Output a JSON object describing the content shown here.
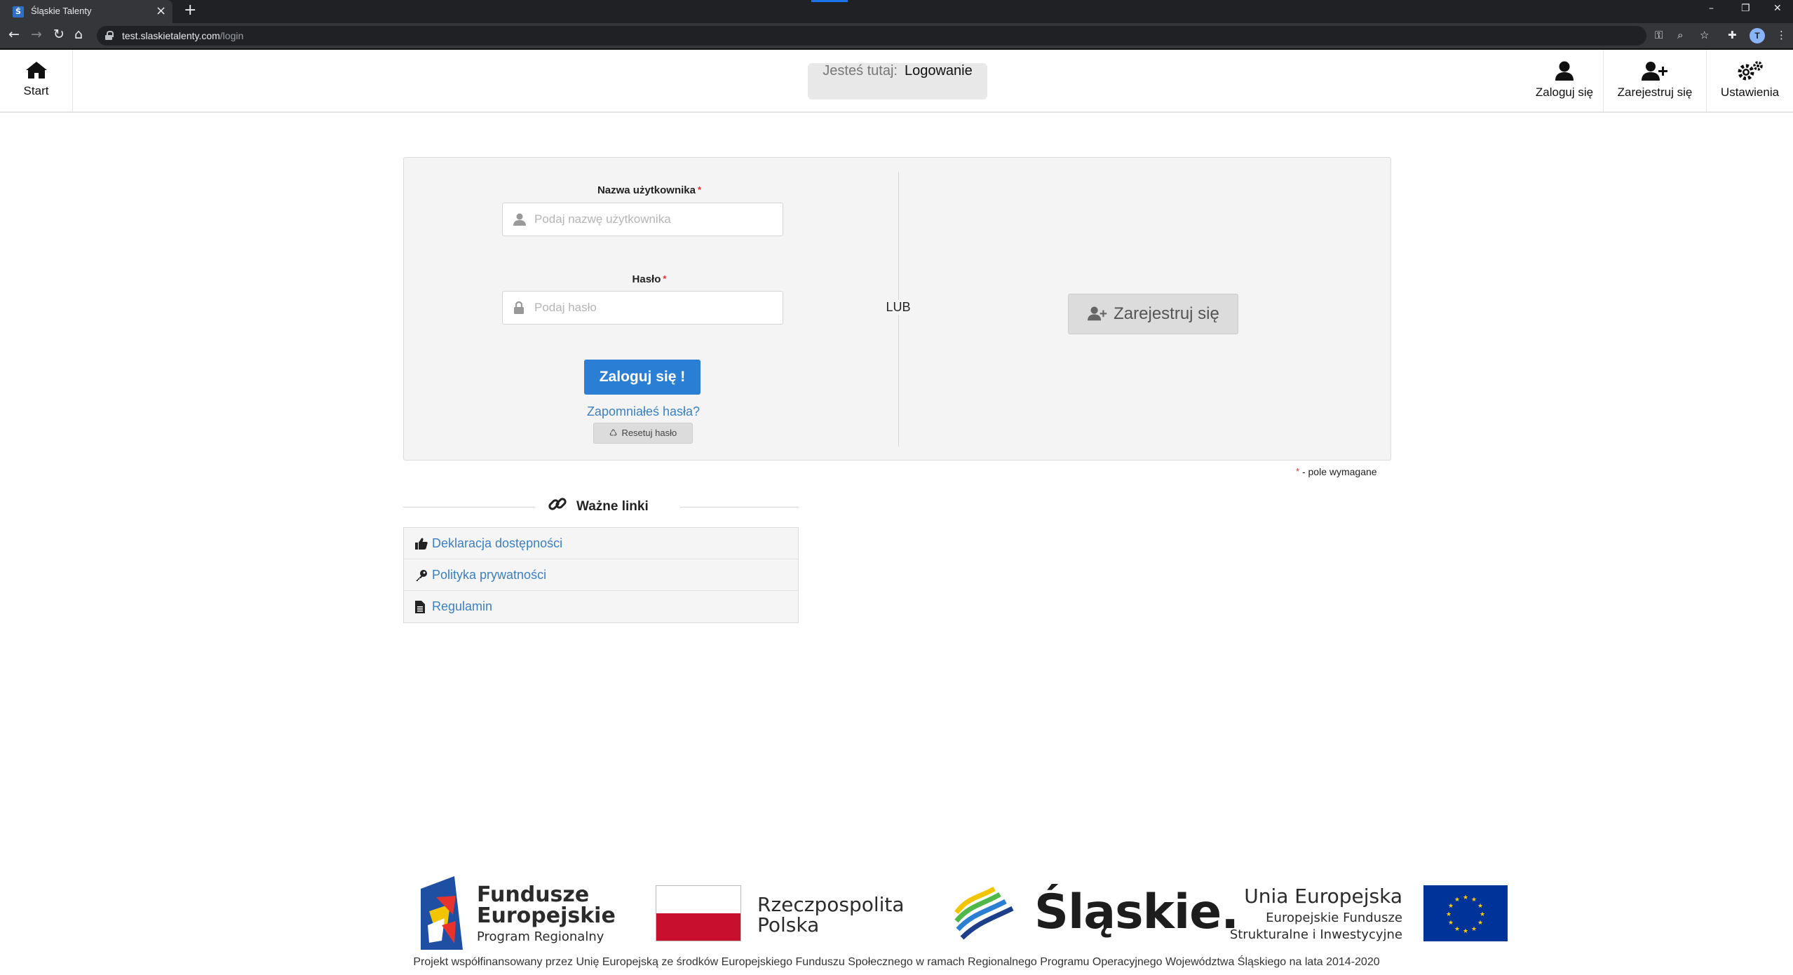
{
  "browser": {
    "tab_title": "Śląskie Talenty",
    "favicon_letter": "Ś",
    "url_host": "test.slaskietalenty.com",
    "url_path": "/login",
    "profile_initial": "T"
  },
  "header": {
    "start_label": "Start",
    "breadcrumb_prefix": "Jesteś tutaj:",
    "breadcrumb_current": "Logowanie",
    "login_label": "Zaloguj się",
    "register_label": "Zarejestruj się",
    "settings_label": "Ustawienia"
  },
  "login_form": {
    "username_label": "Nazwa użytkownika",
    "username_placeholder": "Podaj nazwę użytkownika",
    "username_value": "",
    "password_label": "Hasło",
    "password_placeholder": "Podaj hasło",
    "password_value": "",
    "required_mark": "*",
    "submit_label": "Zaloguj się !",
    "forgot_label": "Zapomniałeś hasła?",
    "reset_label": "Resetuj hasło",
    "or_label": "LUB",
    "register_button_label": "Zarejestruj się",
    "required_note": "- pole wymagane"
  },
  "important_links": {
    "heading": "Ważne linki",
    "items": [
      {
        "label": "Deklaracja dostępności",
        "icon": "thumbs-up-icon"
      },
      {
        "label": "Polityka prywatności",
        "icon": "key-icon"
      },
      {
        "label": "Regulamin",
        "icon": "document-icon"
      }
    ]
  },
  "footer": {
    "fe_line1": "Fundusze",
    "fe_line2": "Europejskie",
    "fe_sub": "Program Regionalny",
    "pl_line1": "Rzeczpospolita",
    "pl_line2": "Polska",
    "slaskie": "Śląskie.",
    "ue_title": "Unia Europejska",
    "ue_sub1": "Europejskie Fundusze",
    "ue_sub2": "Strukturalne i Inwestycyjne",
    "note": "Projekt współfinansowany przez Unię Europejską ze środków Europejskiego Funduszu Społecznego w ramach Regionalnego Programu Operacyjnego Województwa Śląskiego na lata 2014-2020"
  },
  "colors": {
    "primary_button": "#2a7fd4",
    "link": "#3c7fc3",
    "required": "#e03030",
    "panel_bg": "#f4f4f4"
  }
}
